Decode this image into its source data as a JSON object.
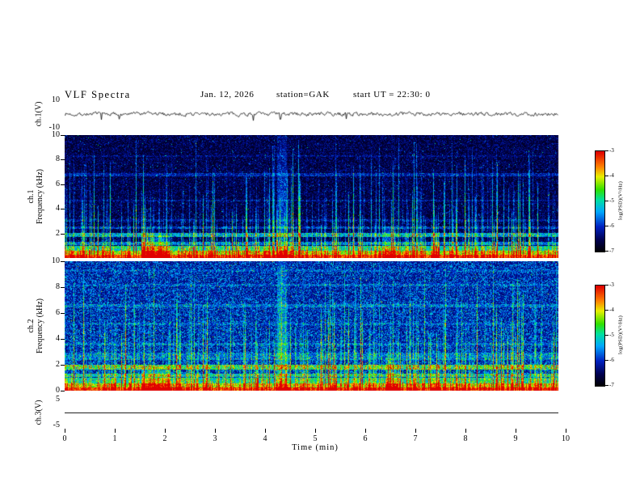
{
  "header": {
    "title": "VLF  Spectra",
    "date": "Jan. 12, 2026",
    "station": "station=GAK",
    "start_ut": "start UT  =   22:30: 0"
  },
  "x_axis": {
    "label": "Time  (min)",
    "ticks": [
      0,
      1,
      2,
      3,
      4,
      5,
      6,
      7,
      8,
      9,
      10
    ],
    "range_min": [
      0,
      10
    ],
    "data_end_min": 9.85
  },
  "chart_data": [
    {
      "type": "line",
      "panel": "ch1-waveform",
      "ylabel": "ch.1(V)",
      "ylim": [
        -10,
        10
      ],
      "yticks": [
        10,
        -10
      ],
      "signal": {
        "description": "broadband noise centered on 0 V with sporadic spikes",
        "mean_v": 0,
        "noise_amp_v": 1.4,
        "spike_amp_v": 5,
        "spike_times_min": [
          4.3
        ],
        "seed": 7
      }
    },
    {
      "type": "heatmap",
      "panel": "ch1-spectrogram",
      "ylabel_lines": [
        "ch.1",
        "Frequency  (kHz)"
      ],
      "ylim_khz": [
        0,
        10
      ],
      "yticks": [
        10,
        8,
        6,
        4,
        2
      ],
      "colorbar": {
        "label": "log(PSD)(V²/Hz)",
        "ticks": [
          -3,
          -4,
          -5,
          -6,
          -7
        ],
        "range": [
          -7,
          -3
        ]
      },
      "texture": {
        "description": "dark background with dense vertical sferic streaks, strong red/yellow band below 1 kHz, faint power-line harmonics",
        "seed": 101,
        "base": 0.05,
        "base_var": 0.1,
        "streak_prob": 0.55,
        "hlines_khz": [
          {
            "f": 1.2,
            "w": 0.14,
            "s": 0.32
          },
          {
            "f": 1.9,
            "w": 0.16,
            "s": 0.4
          },
          {
            "f": 2.5,
            "w": 0.1,
            "s": 0.2
          },
          {
            "f": 3.1,
            "w": 0.09,
            "s": 0.12
          },
          {
            "f": 4.7,
            "w": 0.08,
            "s": 0.1
          },
          {
            "f": 6.8,
            "w": 0.11,
            "s": 0.16
          },
          {
            "f": 8.3,
            "w": 0.07,
            "s": 0.08
          }
        ],
        "events": [
          {
            "t": 1.8,
            "w": 0.28,
            "fmax": 1.9,
            "s": 0.45
          },
          {
            "t": 4.33,
            "w": 0.1,
            "fmax": 10,
            "s": 0.3
          },
          {
            "t": 6.5,
            "w": 0.1,
            "fmax": 2.6,
            "s": 0.4
          },
          {
            "t": 7.4,
            "w": 0.08,
            "fmax": 2.0,
            "s": 0.35
          }
        ]
      }
    },
    {
      "type": "heatmap",
      "panel": "ch2-spectrogram",
      "ylabel_lines": [
        "ch.2",
        "Frequency  (kHz)"
      ],
      "ylim_khz": [
        0,
        10
      ],
      "yticks": [
        10,
        8,
        6,
        4,
        2,
        0
      ],
      "colorbar": {
        "label": "log(PSD)(V²/Hz)",
        "ticks": [
          -3,
          -4,
          -5,
          -6,
          -7
        ],
        "range": [
          -7,
          -3
        ]
      },
      "texture": {
        "description": "brighter blue noisy background, vertical sferic streaks, yellow/green band below 1 kHz, green harmonic near 1.9 kHz",
        "seed": 202,
        "base": 0.15,
        "base_var": 0.16,
        "streak_prob": 0.6,
        "hlines_khz": [
          {
            "f": 1.2,
            "w": 0.12,
            "s": 0.3
          },
          {
            "f": 1.85,
            "w": 0.18,
            "s": 0.45
          },
          {
            "f": 2.7,
            "w": 0.3,
            "s": 0.14
          },
          {
            "f": 3.6,
            "w": 0.1,
            "s": 0.12
          },
          {
            "f": 5.2,
            "w": 0.1,
            "s": 0.1
          },
          {
            "f": 6.6,
            "w": 0.12,
            "s": 0.14
          },
          {
            "f": 8.2,
            "w": 0.1,
            "s": 0.1
          },
          {
            "f": 9.3,
            "w": 0.08,
            "s": 0.08
          }
        ],
        "events": [
          {
            "t": 1.8,
            "w": 0.28,
            "fmax": 1.9,
            "s": 0.45
          },
          {
            "t": 4.33,
            "w": 0.1,
            "fmax": 10,
            "s": 0.3
          },
          {
            "t": 6.5,
            "w": 0.1,
            "fmax": 2.6,
            "s": 0.4
          },
          {
            "t": 7.4,
            "w": 0.08,
            "fmax": 2.0,
            "s": 0.35
          }
        ]
      }
    },
    {
      "type": "line",
      "panel": "ch3-waveform",
      "ylabel": "ch.3(V)",
      "ylim": [
        -7,
        7
      ],
      "yticks": [
        5,
        -5
      ],
      "signal": {
        "description": "flat line at 0 V",
        "constant_v": 0
      }
    }
  ]
}
